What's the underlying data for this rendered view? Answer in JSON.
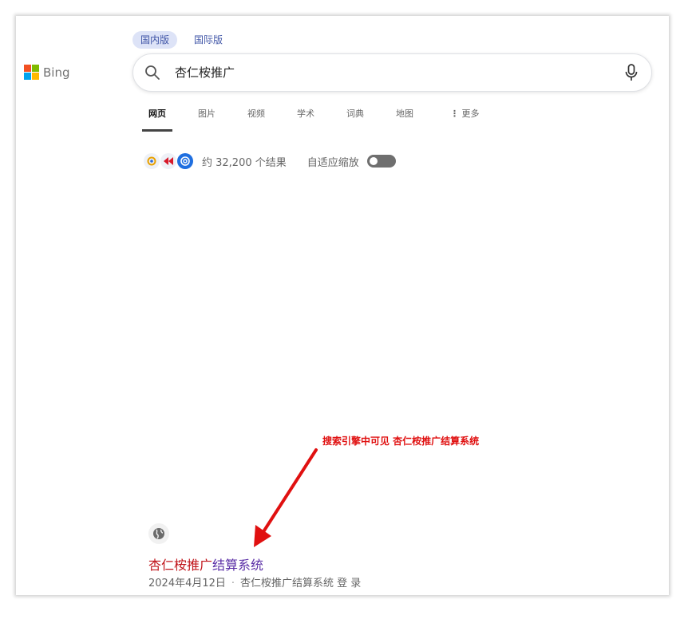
{
  "brand": {
    "name": "Bing",
    "colors": [
      "#f25022",
      "#7fba00",
      "#00a4ef",
      "#ffb900"
    ]
  },
  "regions": [
    "国内版",
    "国际版"
  ],
  "search": {
    "query": "杏仁桉推广"
  },
  "tabs": [
    "网页",
    "图片",
    "视频",
    "学术",
    "词典",
    "地图",
    "更多"
  ],
  "results_info": {
    "count": "约 32,200 个结果",
    "adaptive_zoom": "自适应缩放"
  },
  "annotation": "搜索引擎中可见 杏仁桉推广结算系统",
  "result": {
    "title_highlight": "杏仁桉推广",
    "title_rest": "结算系统",
    "date": "2024年4月12日",
    "separator": "·",
    "snippet": "杏仁桉推广结算系统 登 录"
  },
  "accent_color": "#e01010"
}
